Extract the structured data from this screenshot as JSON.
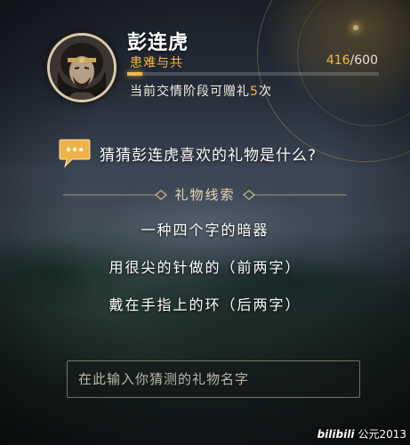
{
  "character": {
    "name": "彭连虎",
    "relationship_stage": "患难与共",
    "affinity_current": "416",
    "affinity_separator": "/",
    "affinity_max": "600",
    "affinity_progress": 0.06,
    "gift_text_prefix": "当前交情阶段可赠礼",
    "gift_count": "5",
    "gift_text_suffix": "次"
  },
  "question": {
    "icon": "speech-bubble-icon",
    "text": "猜猜彭连虎喜欢的礼物是什么?"
  },
  "clues": {
    "title": "礼物线索",
    "items": [
      "一种四个字的暗器",
      "用很尖的针做的（前两字）",
      "戴在手指上的环（后两字）"
    ]
  },
  "answer_input": {
    "value": "",
    "placeholder": "在此输入你猜测的礼物名字"
  },
  "watermark": {
    "logo": "bilibili",
    "text": "公元2013"
  },
  "colors": {
    "accent_gold": "#f5b93c",
    "text_main": "#ffffff",
    "clue_title": "#e7d7b0"
  }
}
